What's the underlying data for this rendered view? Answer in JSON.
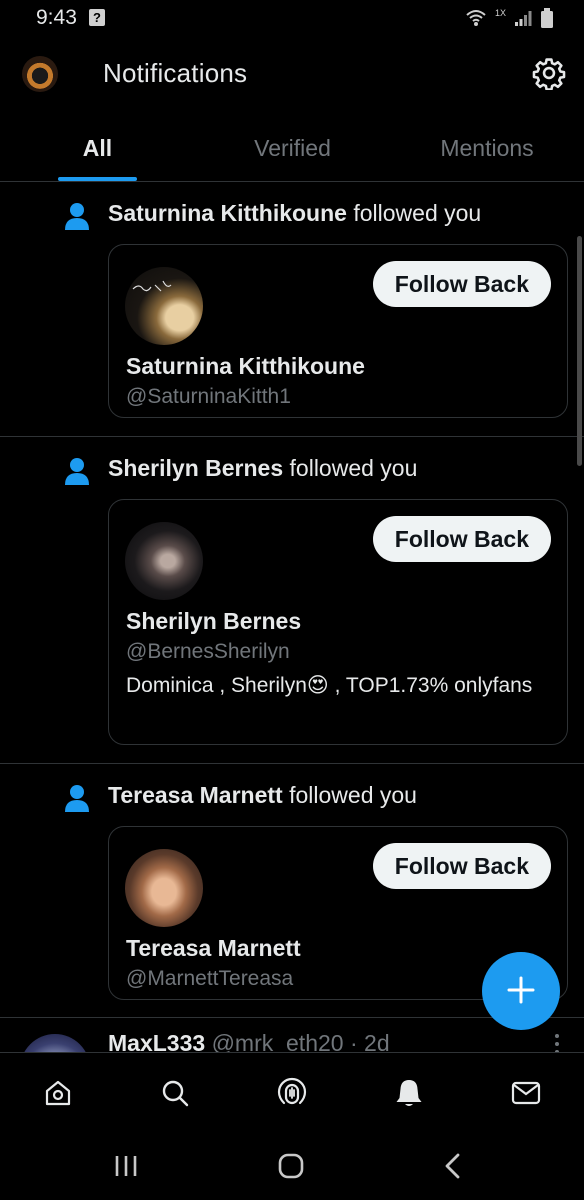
{
  "status_bar": {
    "time": "9:43",
    "notice_icon": "help-box-icon",
    "icons": [
      "wifi-icon",
      "lte-icon",
      "signal-icon",
      "battery-icon"
    ],
    "network_label": "1X"
  },
  "header": {
    "title": "Notifications",
    "avatar_icon": "profile-avatar",
    "settings_icon": "gear-icon"
  },
  "tabs": [
    {
      "label": "All",
      "active": true
    },
    {
      "label": "Verified",
      "active": false
    },
    {
      "label": "Mentions",
      "active": false
    }
  ],
  "notifications": [
    {
      "name": "Saturnina Kitthikoune",
      "action": "followed you",
      "card": {
        "display_name": "Saturnina Kitthikoune",
        "handle": "@SaturninaKitth1",
        "bio": "",
        "button": "Follow Back"
      }
    },
    {
      "name": "Sherilyn Bernes",
      "action": "followed you",
      "card": {
        "display_name": "Sherilyn Bernes",
        "handle": "@BernesSherilyn",
        "bio": "Dominica , Sherilyn😍 , TOP1.73% onlyfans",
        "button": "Follow Back"
      }
    },
    {
      "name": "Tereasa Marnett",
      "action": "followed you",
      "card": {
        "display_name": "Tereasa Marnett",
        "handle": "@MarnettTereasa",
        "bio": "",
        "button": "Follow Back"
      }
    }
  ],
  "tweet_preview": {
    "name": "MaxL333",
    "handle": "@mrk_eth20",
    "separator": "·",
    "time": "2d"
  },
  "fab": {
    "icon": "plus-icon"
  },
  "bottom_nav": [
    "home-icon",
    "search-icon",
    "spaces-icon",
    "notifications-icon",
    "messages-icon"
  ],
  "system_nav": [
    "recents-icon",
    "home-circle-icon",
    "back-icon"
  ],
  "colors": {
    "accent": "#1d9bf0",
    "background": "#000000",
    "text": "#e7e9ea",
    "muted": "#71767b",
    "border": "#2f3336"
  }
}
